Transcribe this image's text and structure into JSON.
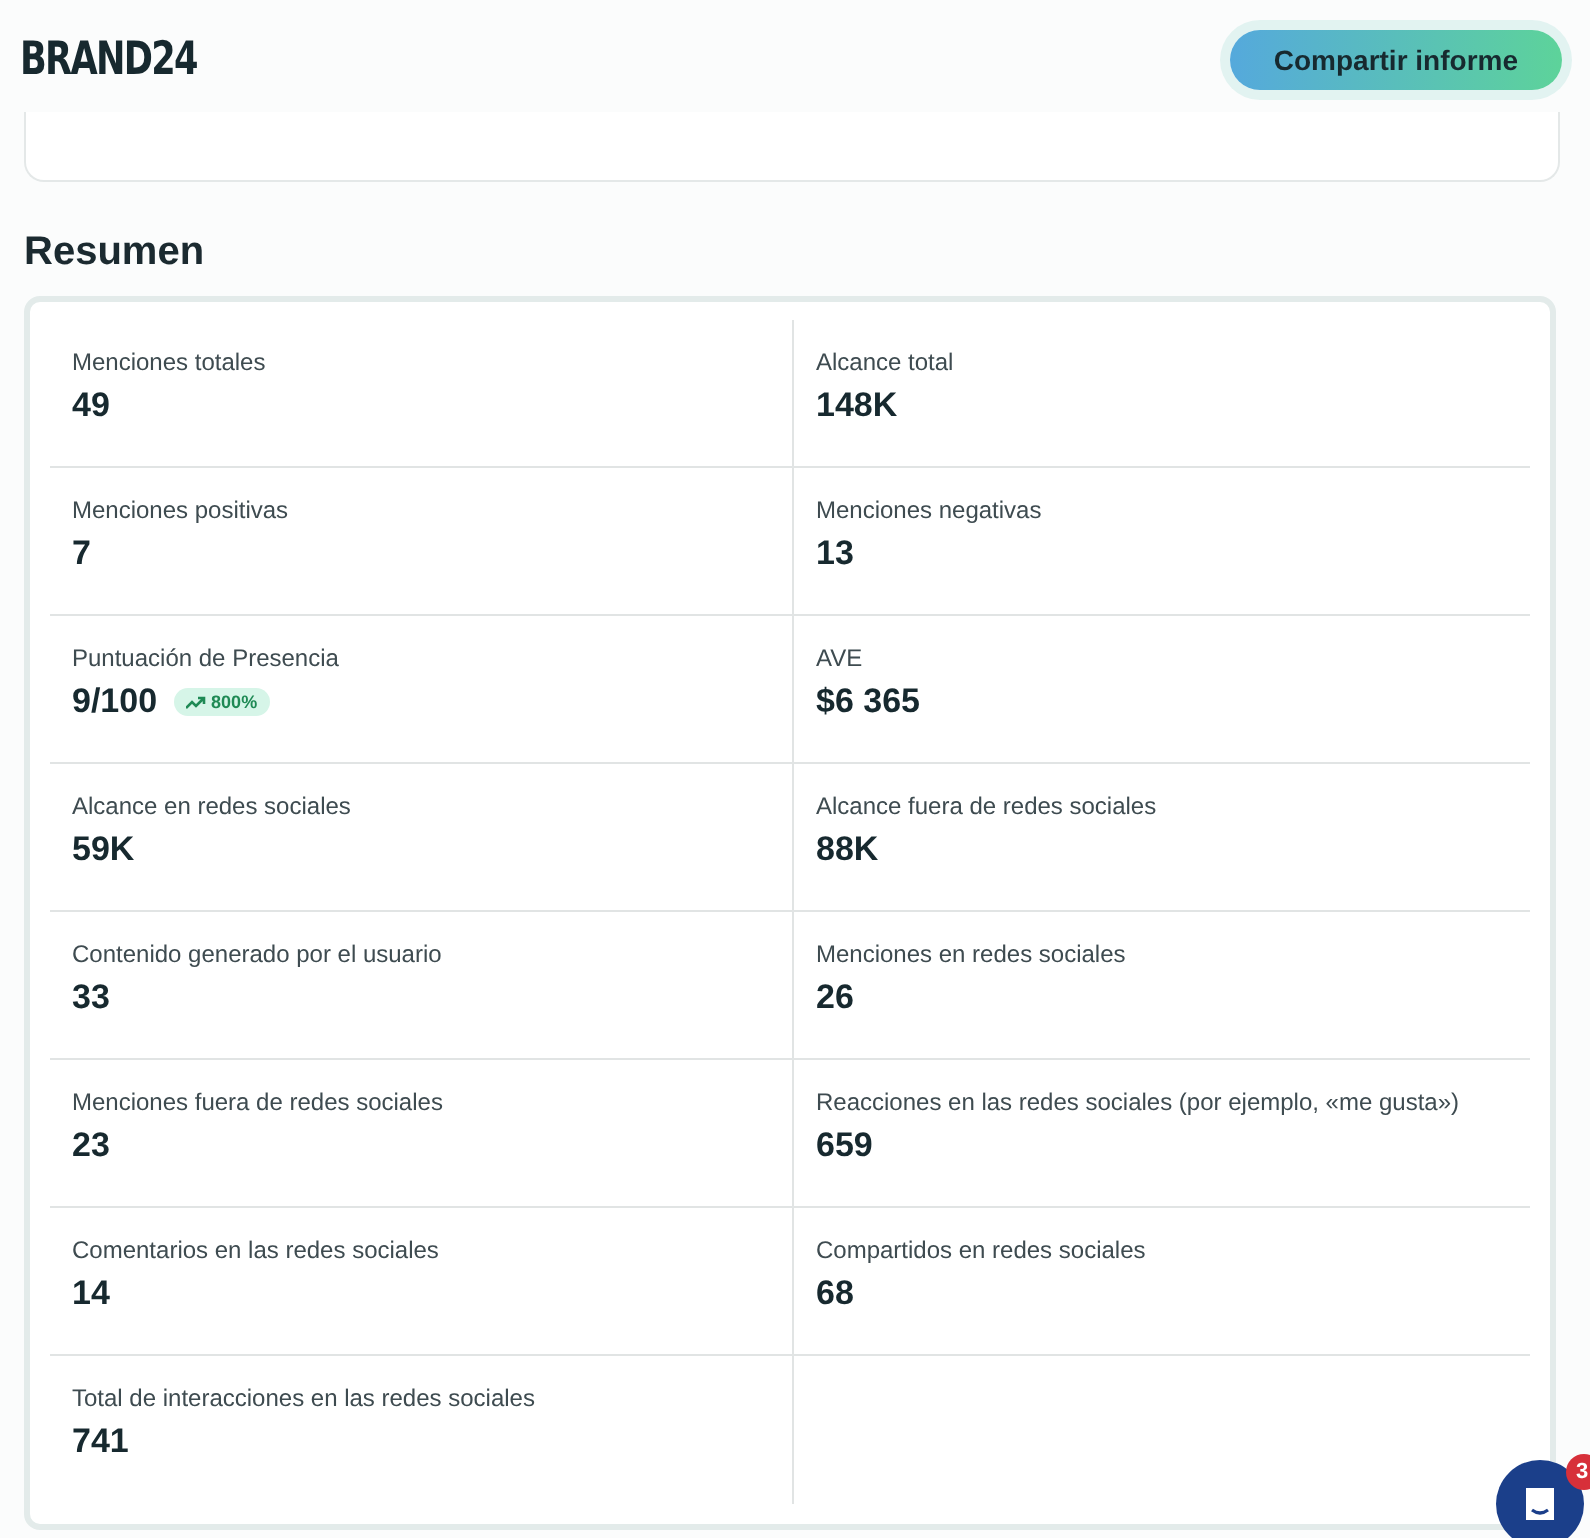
{
  "header": {
    "logo": "BRAND24",
    "share_button": "Compartir informe"
  },
  "summary": {
    "title": "Resumen",
    "metrics": [
      {
        "label": "Menciones totales",
        "value": "49"
      },
      {
        "label": "Alcance total",
        "value": "148K"
      },
      {
        "label": "Menciones positivas",
        "value": "7"
      },
      {
        "label": "Menciones negativas",
        "value": "13"
      },
      {
        "label": "Puntuación de Presencia",
        "value": "9/100",
        "change": "800%"
      },
      {
        "label": "AVE",
        "value": "$6 365"
      },
      {
        "label": "Alcance en redes sociales",
        "value": "59K"
      },
      {
        "label": "Alcance fuera de redes sociales",
        "value": "88K"
      },
      {
        "label": "Contenido generado por el usuario",
        "value": "33"
      },
      {
        "label": "Menciones en redes sociales",
        "value": "26"
      },
      {
        "label": "Menciones fuera de redes sociales",
        "value": "23"
      },
      {
        "label": "Reacciones en las redes sociales (por ejemplo, «me gusta»)",
        "value": "659"
      },
      {
        "label": "Comentarios en las redes sociales",
        "value": "14"
      },
      {
        "label": "Compartidos en redes sociales",
        "value": "68"
      },
      {
        "label": "Total de interacciones en las redes sociales",
        "value": "741"
      }
    ]
  },
  "chat": {
    "badge": "3"
  }
}
